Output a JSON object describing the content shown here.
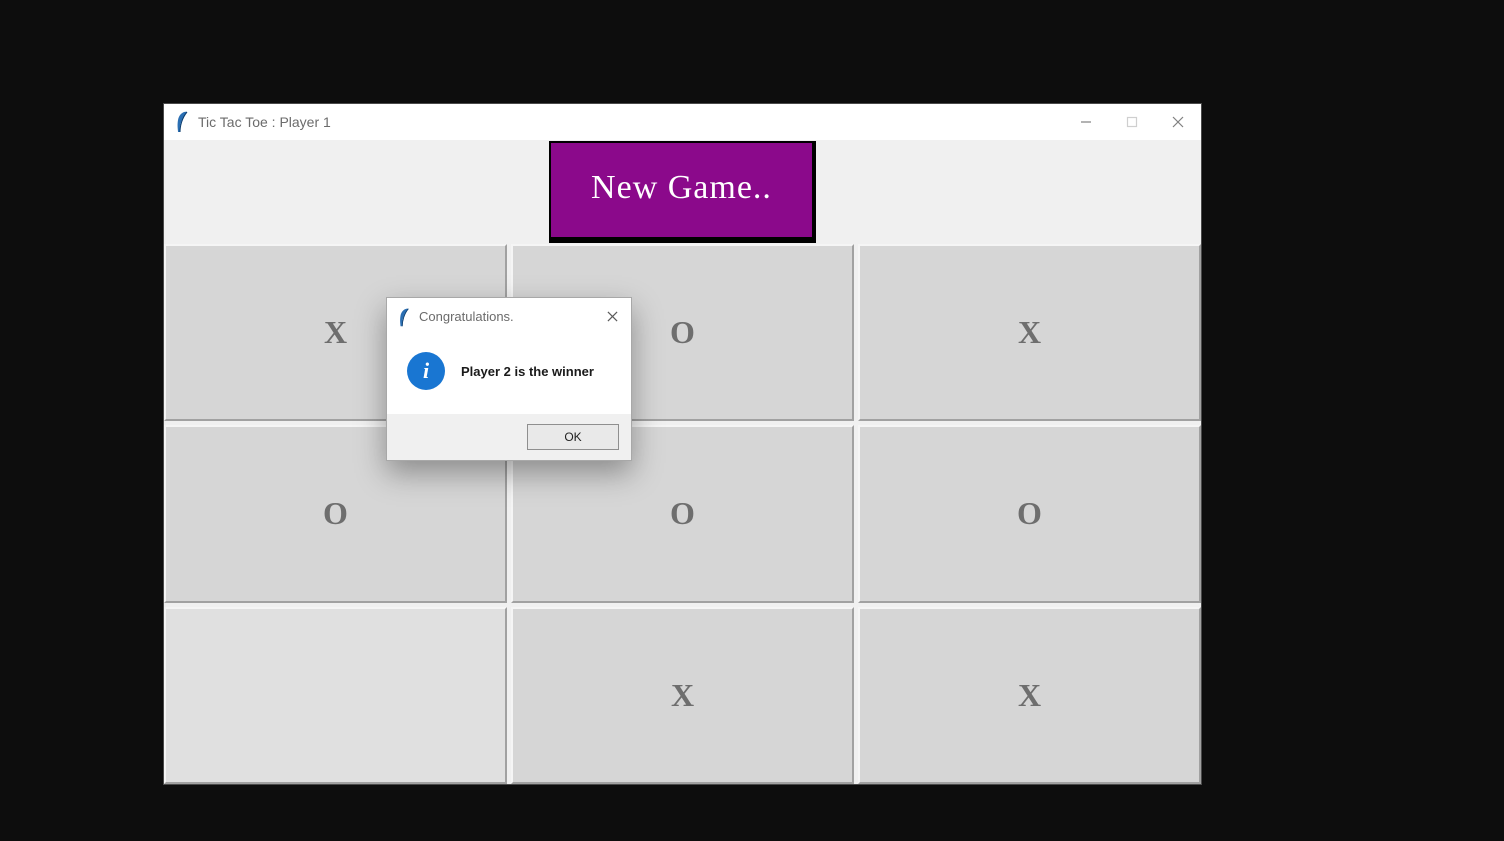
{
  "window": {
    "title": "Tic Tac Toe : Player 1"
  },
  "toolbar": {
    "new_game_label": "New Game.."
  },
  "board": {
    "cells": [
      "X",
      "O",
      "X",
      "O",
      "O",
      "O",
      "",
      "X",
      "X"
    ]
  },
  "dialog": {
    "title": "Congratulations.",
    "message": "Player 2 is the winner",
    "ok_label": "OK",
    "info_glyph": "i"
  }
}
